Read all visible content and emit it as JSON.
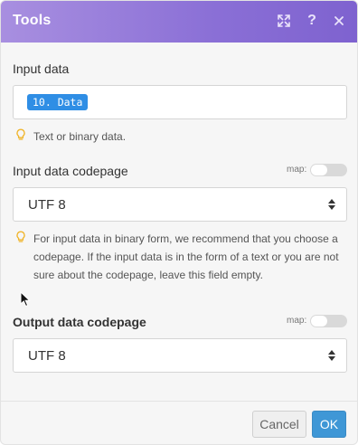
{
  "dialog": {
    "title": "Tools"
  },
  "fields": {
    "input_data": {
      "label": "Input data",
      "token": "10. Data",
      "hint": "Text or binary data."
    },
    "input_codepage": {
      "label": "Input data codepage",
      "map_label": "map:",
      "map_on": false,
      "value": "UTF 8",
      "hint": "For input data in binary form, we recommend that you choose a codepage. If the input data is in the form of a text or you are not sure about the codepage, leave this field empty."
    },
    "output_codepage": {
      "label": "Output data codepage",
      "map_label": "map:",
      "map_on": false,
      "value": "UTF 8"
    }
  },
  "footer": {
    "cancel_label": "Cancel",
    "ok_label": "OK"
  },
  "colors": {
    "header_start": "#a88fe0",
    "header_end": "#7e62cf",
    "token_bg": "#2f8ee5",
    "ok_bg": "#3f97d6",
    "bulb": "#f0b429"
  },
  "icons": {
    "expand": "expand-icon",
    "help": "help-icon",
    "close": "close-icon",
    "hint": "lightbulb-icon",
    "select": "updown-caret-icon"
  }
}
